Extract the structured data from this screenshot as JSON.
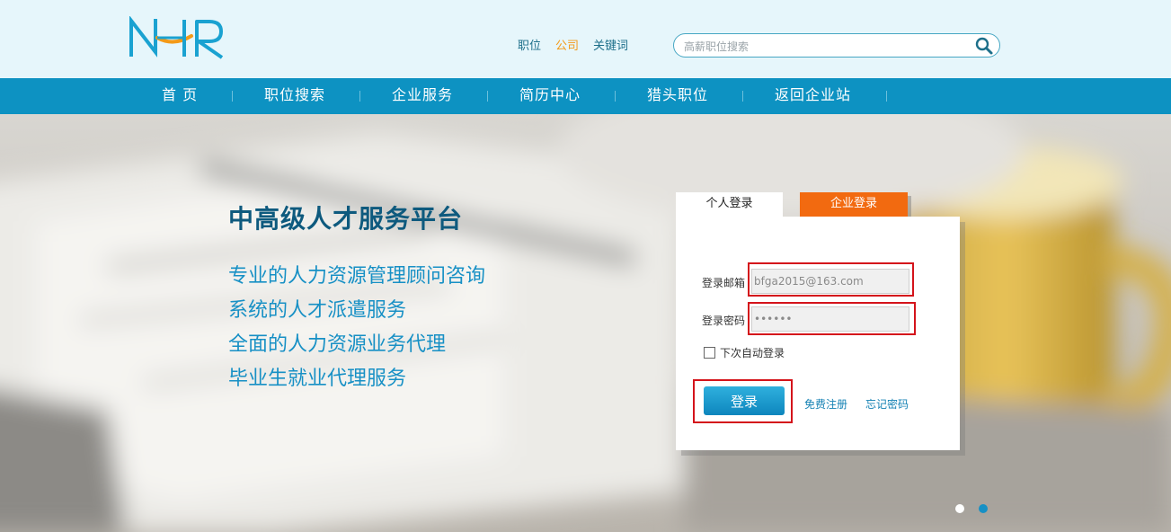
{
  "header": {
    "logo_text": "NHR",
    "top_links": [
      "职位",
      "公司",
      "关键词"
    ],
    "active_link": "公司",
    "search_placeholder": "高薪职位搜索"
  },
  "nav": {
    "items": [
      "首 页",
      "职位搜索",
      "企业服务",
      "简历中心",
      "猎头职位",
      "返回企业站"
    ]
  },
  "hero": {
    "title": "中高级人才服务平台",
    "lines": [
      "专业的人力资源管理顾问咨询",
      "系统的人才派遣服务",
      "全面的人力资源业务代理",
      "毕业生就业代理服务"
    ]
  },
  "login": {
    "tab_personal": "个人登录",
    "tab_enterprise": "企业登录",
    "email_label": "登录邮箱",
    "email_value": "bfga2015@163.com",
    "password_label": "登录密码",
    "password_value": "••••••",
    "remember_label": "下次自动登录",
    "login_button": "登录",
    "register_link": "免费注册",
    "forgot_link": "忘记密码"
  },
  "slider": {
    "count": 2,
    "active_index": 1
  },
  "colors": {
    "nav_bg": "#0d92c2",
    "header_bg": "#e6f6fb",
    "accent_orange": "#f26a10",
    "highlight_red": "#d4131b",
    "title_dark_blue": "#0e5a7e",
    "text_blue": "#1790c5"
  }
}
